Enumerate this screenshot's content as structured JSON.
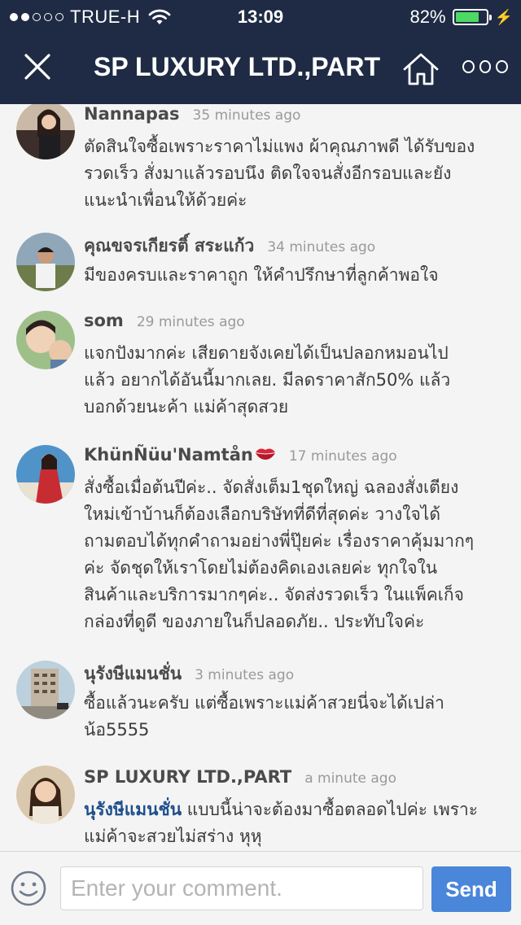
{
  "status_bar": {
    "carrier": "TRUE-H",
    "signal_bars_filled": 2,
    "signal_bars_total": 5,
    "time": "13:09",
    "battery_text": "82%",
    "battery_level": 0.82,
    "charging": true,
    "colors": {
      "background": "#1f2b44",
      "battery_fill": "#4cd964"
    }
  },
  "header": {
    "title": "SP LUXURY LTD.,PART",
    "close_icon": "close-icon",
    "home_icon": "home-icon",
    "more_icon": "more-options-icon"
  },
  "comments": [
    {
      "name": "Nannapas",
      "time": "35 minutes ago",
      "text_lines": [
        "ตัดสินใจซื้อเพราะราคาไม่แพง ผ้าคุณภาพดี ได้รับของ",
        "รวดเร็ว สั่งมาแล้วรอบนึง ติดใจจนสั่งอีกรอบและยัง",
        "แนะนำเพื่อนให้ด้วยค่ะ"
      ]
    },
    {
      "name": "คุณขจรเกียรติ์ สระแก้ว",
      "time": "34 minutes ago",
      "text_lines": [
        "มีของครบและราคาถูก ให้คำปรึกษาที่ลูกค้าพอใจ"
      ]
    },
    {
      "name": "som",
      "time": "29 minutes ago",
      "text_lines": [
        "แจกปังมากค่ะ เสียดายจังเคยได้เป็นปลอกหมอนไป",
        "แล้ว อยากได้อันนี้มากเลย. มีลดราคาสัก50% แล้ว",
        "บอกด้วยนะค้า แม่ค้าสุดสวย"
      ]
    },
    {
      "name": "KhünÑüu'Namtån",
      "name_emoji": "kiss-lips-icon",
      "time": "17 minutes ago",
      "text_lines": [
        "สั่งซื้อเมื่อต้นปีค่ะ.. จัดสั่งเต็ม1ชุดใหญ่ ฉลองสั่งเตียง",
        "ใหม่เข้าบ้านก็ต้องเลือกบริษัทที่ดีที่สุดค่ะ วางใจได้",
        "ถามตอบได้ทุกคำถามอย่างพี่ปุ๊ยค่ะ เรื่องราคาคุ้มมากๆ",
        "ค่ะ จัดชุดให้เราโดยไม่ต้องคิดเองเลยค่ะ ทุกใจใน",
        "สินค้าและบริการมากๆค่ะ.. จัดส่งรวดเร็ว ในแพ็คเก็จ",
        "กล่องที่ดูดี  ของภายในก็ปลอดภัย.. ประทับใจค่ะ"
      ]
    },
    {
      "name": "นุรังษีแมนชั่น",
      "time": "3 minutes ago",
      "text_lines": [
        "ซื้อแล้วนะครับ แต่ซื้อเพราะแม่ค้าสวยนี่จะได้เปล่า",
        "น้อ5555"
      ]
    },
    {
      "name": "SP LUXURY LTD.,PART",
      "time": "a minute ago",
      "mention": "นุรังษีแมนชั่น",
      "text_lines": [
        "แบบนี้น่าจะต้องมาซื้อตลอดไปค่ะ เพราะ",
        "แม่ค้าจะสวยไม่สร่าง หุหุ"
      ]
    }
  ],
  "input_bar": {
    "emoji_icon": "emoji-smiley-icon",
    "placeholder": "Enter your comment.",
    "value": "",
    "send_label": "Send",
    "colors": {
      "send": "#4a86d9"
    }
  }
}
